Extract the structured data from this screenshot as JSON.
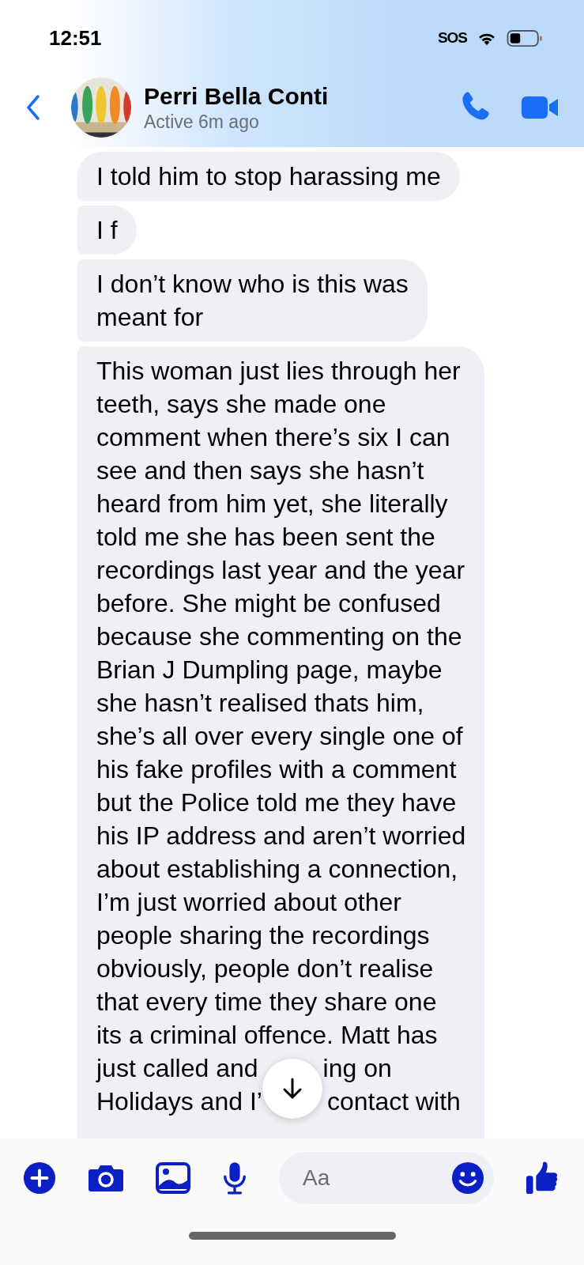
{
  "status_bar": {
    "time": "12:51",
    "sos": "SOS"
  },
  "header": {
    "name": "Perri Bella Conti",
    "presence": "Active 6m ago"
  },
  "messages": [
    {
      "kind": "single",
      "lines": [
        "I told him to stop harassing me"
      ]
    },
    {
      "kind": "single",
      "lines": [
        "I f"
      ]
    },
    {
      "kind": "single",
      "lines": [
        "I don’t know who is this was",
        "meant for"
      ]
    },
    {
      "kind": "single",
      "lines": [
        "This woman just lies through her",
        "teeth, says she made one",
        "comment when there’s six I can",
        "see and then says she hasn’t",
        "heard from him yet, she literally",
        "told me she has been sent the",
        "recordings last year and the year",
        "before. She might be confused",
        "because she commenting on the",
        "Brian J Dumpling page, maybe",
        "she hasn’t realised thats him,",
        "she’s all over every single one of",
        "his fake profiles with a comment",
        "but the Police told me they have",
        "his IP address and aren’t worried",
        "about establishing a connection,",
        "I’m just worried about other",
        "people sharing the recordings",
        "obviously, people don’t realise",
        "that every time they share one",
        "its a criminal offence. Matt has",
        [
          "just called and",
          "ing on"
        ],
        [
          "Holidays and I’",
          "contact with"
        ]
      ]
    }
  ],
  "composer": {
    "placeholder": "Aa"
  }
}
